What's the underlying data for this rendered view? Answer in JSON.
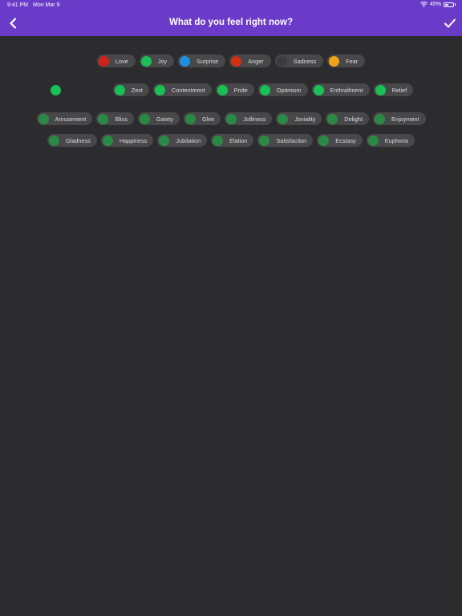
{
  "status_bar": {
    "time": "9:41 PM",
    "date": "Mon Mar 9",
    "battery_text": "45%",
    "battery_level": 0.45
  },
  "header": {
    "title": "What do you feel right now?",
    "back_icon": "chevron-left-icon",
    "done_icon": "checkmark-icon"
  },
  "colors": {
    "header_bg": "#6a3bc9",
    "background": "#2c2b2e",
    "chip_bg": "#48474a",
    "love": "#d51f1a",
    "joy": "#19c155",
    "surprise": "#1e8fe0",
    "anger": "#d4300f",
    "sadness": "#3c3b3e",
    "fear": "#f1a413",
    "sub_emotion": "#1fb04f",
    "leaf_emotion": "#2a8a45"
  },
  "emotions": [
    {
      "label": "Love",
      "color": "#d51f1a"
    },
    {
      "label": "Joy",
      "color": "#19c155"
    },
    {
      "label": "Surprise",
      "color": "#1e8fe0"
    },
    {
      "label": "Anger",
      "color": "#d4300f"
    },
    {
      "label": "Sadness",
      "color": "#3c3b3e"
    },
    {
      "label": "Fear",
      "color": "#f1a413"
    }
  ],
  "joy_sub": [
    {
      "label": "",
      "color": "#19c155"
    },
    {
      "label": "Zest",
      "color": "#19c155"
    },
    {
      "label": "Contentment",
      "color": "#19c155"
    },
    {
      "label": "Pride",
      "color": "#19c155"
    },
    {
      "label": "Optimism",
      "color": "#19c155"
    },
    {
      "label": "Enthrallment",
      "color": "#19c155"
    },
    {
      "label": "Relief",
      "color": "#19c155"
    }
  ],
  "cheerfulness_row1": [
    {
      "label": "Amusement"
    },
    {
      "label": "Bliss"
    },
    {
      "label": "Gaiety"
    },
    {
      "label": "Glee"
    },
    {
      "label": "Jolliness"
    },
    {
      "label": "Joviality"
    },
    {
      "label": "Delight"
    },
    {
      "label": "Enjoyment"
    }
  ],
  "cheerfulness_row2": [
    {
      "label": "Gladness"
    },
    {
      "label": "Happiness"
    },
    {
      "label": "Jubilation"
    },
    {
      "label": "Elation"
    },
    {
      "label": "Satisfaction"
    },
    {
      "label": "Ecstasy"
    },
    {
      "label": "Euphoria"
    }
  ]
}
